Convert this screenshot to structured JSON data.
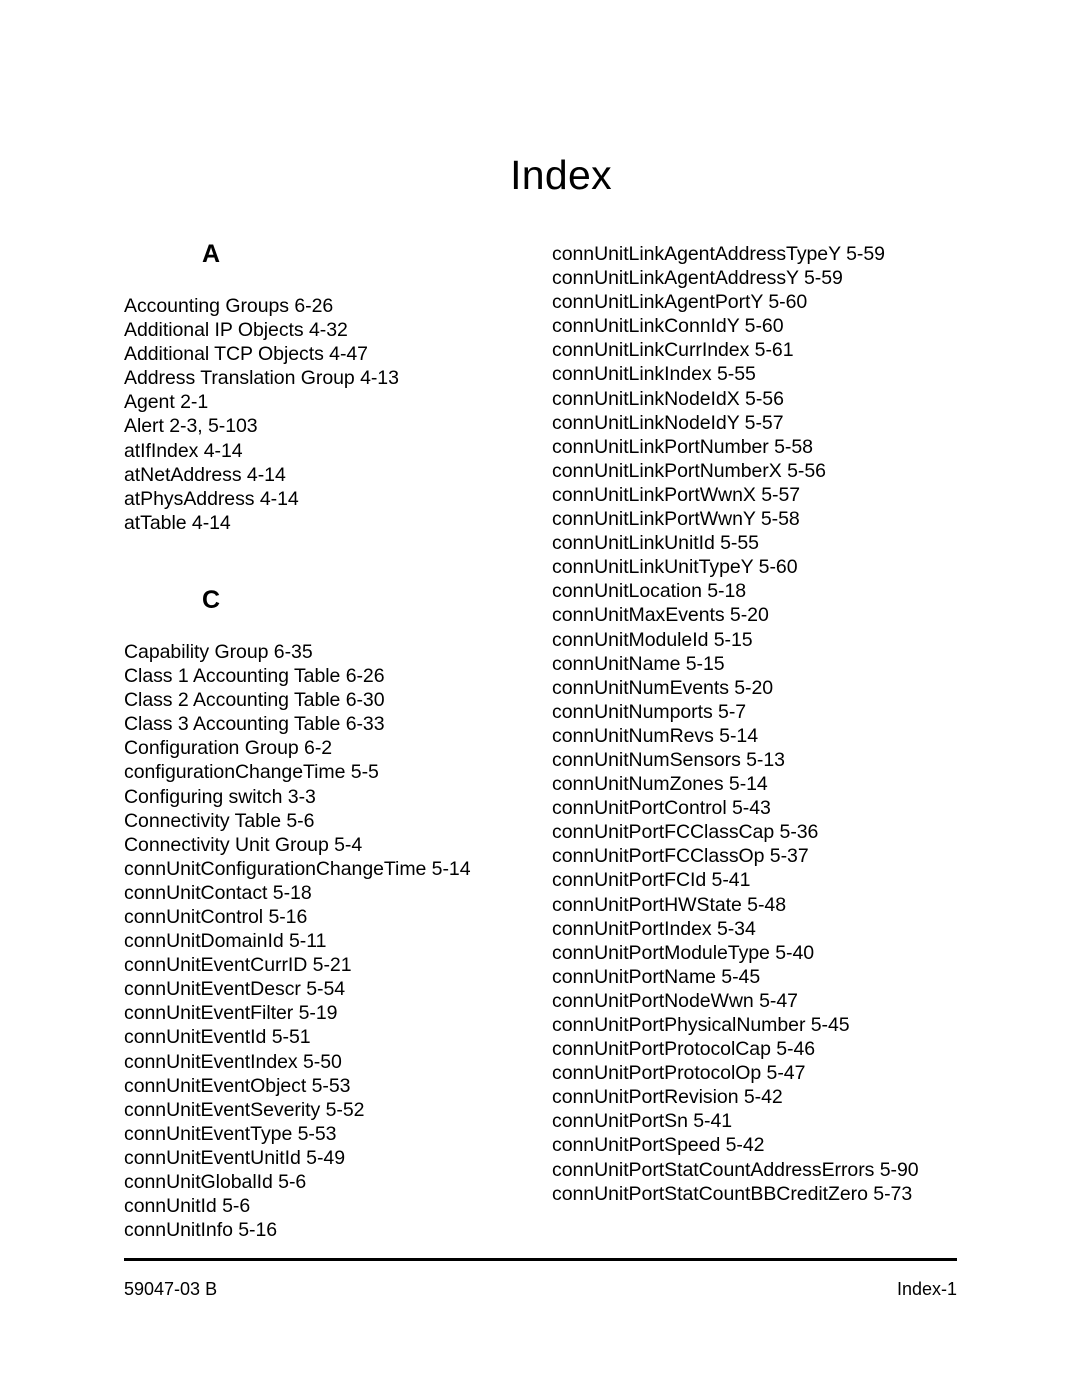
{
  "document": {
    "page_title": "Index"
  },
  "columns": {
    "left": {
      "sections": [
        {
          "letter": "A",
          "entries": [
            "Accounting Groups 6-26",
            "Additional IP Objects 4-32",
            "Additional TCP Objects 4-47",
            "Address Translation Group 4-13",
            "Agent 2-1",
            "Alert 2-3, 5-103",
            "atIfIndex 4-14",
            "atNetAddress 4-14",
            "atPhysAddress 4-14",
            "atTable 4-14"
          ]
        },
        {
          "letter": "C",
          "entries": [
            "Capability Group 6-35",
            "Class 1 Accounting Table 6-26",
            "Class 2 Accounting Table 6-30",
            "Class 3 Accounting Table 6-33",
            "Configuration Group 6-2",
            "configurationChangeTime 5-5",
            "Configuring switch 3-3",
            "Connectivity Table 5-6",
            "Connectivity Unit Group 5-4",
            "connUnitConfigurationChangeTime 5-14",
            "connUnitContact 5-18",
            "connUnitControl 5-16",
            "connUnitDomainId 5-11",
            "connUnitEventCurrID 5-21",
            "connUnitEventDescr 5-54",
            "connUnitEventFilter 5-19",
            "connUnitEventId 5-51",
            "connUnitEventIndex 5-50",
            "connUnitEventObject 5-53",
            "connUnitEventSeverity 5-52",
            "connUnitEventType 5-53",
            "connUnitEventUnitId 5-49",
            "connUnitGlobalId 5-6",
            "connUnitId 5-6",
            "connUnitInfo 5-16"
          ]
        }
      ]
    },
    "right": {
      "entries": [
        "connUnitLinkAgentAddressTypeY 5-59",
        "connUnitLinkAgentAddressY 5-59",
        "connUnitLinkAgentPortY 5-60",
        "connUnitLinkConnIdY 5-60",
        "connUnitLinkCurrIndex 5-61",
        "connUnitLinkIndex 5-55",
        "connUnitLinkNodeIdX 5-56",
        "connUnitLinkNodeIdY 5-57",
        "connUnitLinkPortNumber 5-58",
        "connUnitLinkPortNumberX 5-56",
        "connUnitLinkPortWwnX 5-57",
        "connUnitLinkPortWwnY 5-58",
        "connUnitLinkUnitId 5-55",
        "connUnitLinkUnitTypeY 5-60",
        "connUnitLocation 5-18",
        "connUnitMaxEvents 5-20",
        "connUnitModuleId 5-15",
        "connUnitName 5-15",
        "connUnitNumEvents 5-20",
        "connUnitNumports 5-7",
        "connUnitNumRevs 5-14",
        "connUnitNumSensors 5-13",
        "connUnitNumZones 5-14",
        "connUnitPortControl 5-43",
        "connUnitPortFCClassCap 5-36",
        "connUnitPortFCClassOp 5-37",
        "connUnitPortFCId 5-41",
        "connUnitPortHWState 5-48",
        "connUnitPortIndex 5-34",
        "connUnitPortModuleType 5-40",
        "connUnitPortName 5-45",
        "connUnitPortNodeWwn 5-47",
        "connUnitPortPhysicalNumber 5-45",
        "connUnitPortProtocolCap 5-46",
        "connUnitPortProtocolOp 5-47",
        "connUnitPortRevision 5-42",
        "connUnitPortSn 5-41",
        "connUnitPortSpeed 5-42",
        "connUnitPortStatCountAddressErrors 5-90",
        "connUnitPortStatCountBBCreditZero 5-73"
      ]
    }
  },
  "footer": {
    "document_number": "59047-03  B",
    "page_number": "Index-1"
  }
}
